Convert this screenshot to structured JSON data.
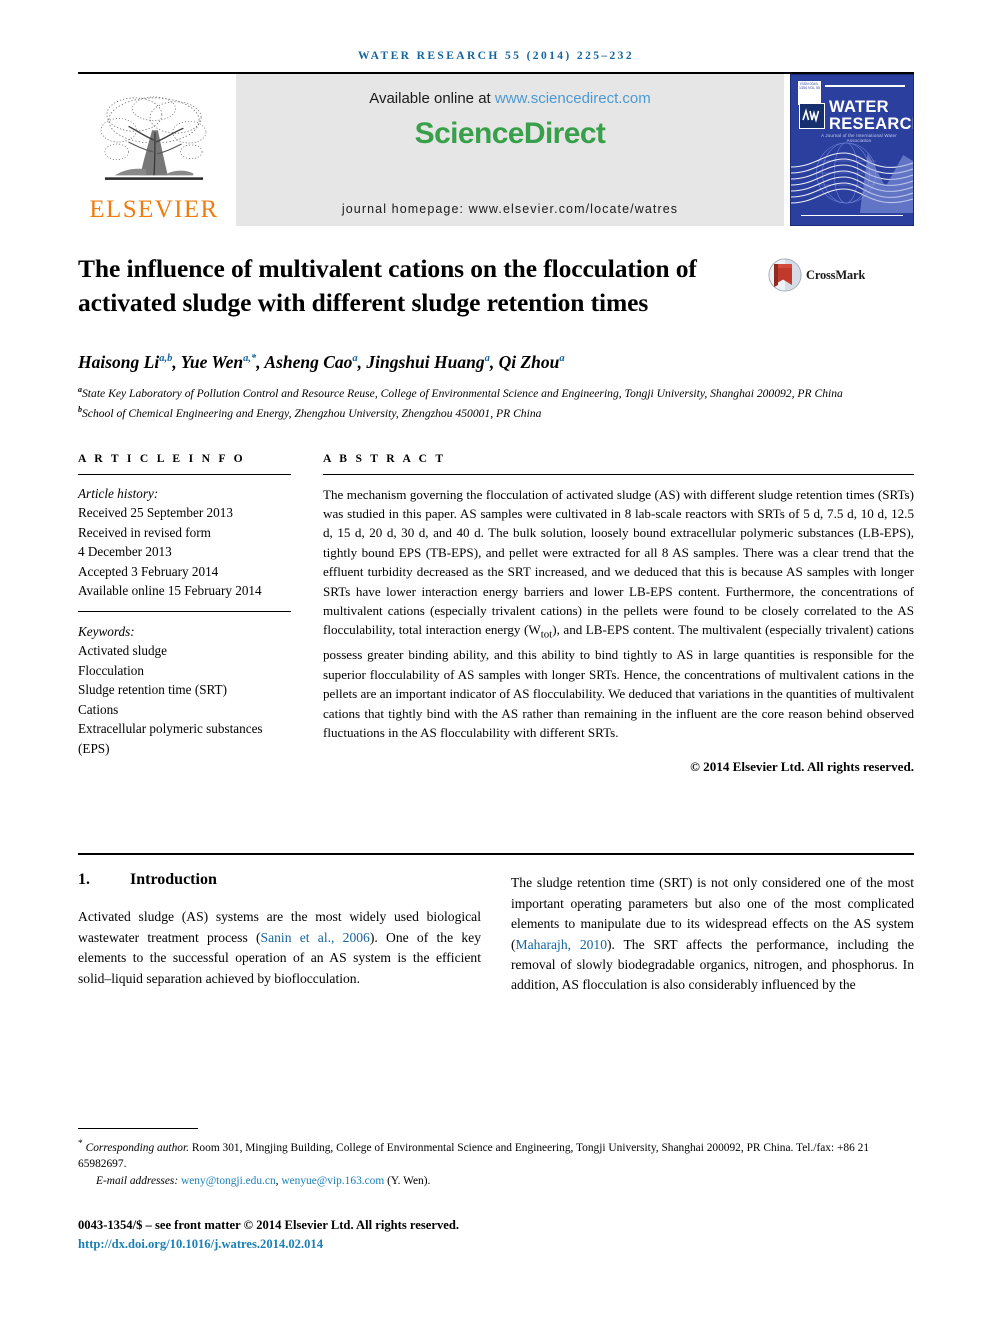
{
  "running_head": "WATER RESEARCH 55 (2014) 225–232",
  "masthead": {
    "publisher_name": "ELSEVIER",
    "available_prefix": "Available online at ",
    "available_url": "www.sciencedirect.com",
    "sciencedirect_logo": "ScienceDirect",
    "journal_homepage": "journal homepage: www.elsevier.com/locate/watres",
    "cover": {
      "title_line1": "WATER",
      "title_line2": "RESEARCH",
      "association_line": "A Journal of the International Water Association",
      "iwa_mark": "IWA",
      "stamp_text": "ISSN 0043-1354 VOL 55"
    },
    "colors": {
      "banner_bg": "#e6e6e6",
      "sciencedirect_green": "#38a04a",
      "link_blue": "#4b9ad4",
      "elsevier_orange": "#ee7d11",
      "cover_blue": "#2b3f9e",
      "running_head_blue": "#15669e"
    }
  },
  "article": {
    "title": "The influence of multivalent cations on the flocculation of activated sludge with different sludge retention times",
    "crossmark_label": "CrossMark",
    "authors": [
      {
        "name": "Haisong Li",
        "sup": "a,b",
        "sep": ", "
      },
      {
        "name": "Yue Wen",
        "sup": "a,*",
        "sep": ", "
      },
      {
        "name": "Asheng Cao",
        "sup": "a",
        "sep": ", "
      },
      {
        "name": "Jingshui Huang",
        "sup": "a",
        "sep": ", "
      },
      {
        "name": "Qi Zhou",
        "sup": "a",
        "sep": ""
      }
    ],
    "affiliations": [
      {
        "sup": "a",
        "text": "State Key Laboratory of Pollution Control and Resource Reuse, College of Environmental Science and Engineering, Tongji University, Shanghai 200092, PR China"
      },
      {
        "sup": "b",
        "text": "School of Chemical Engineering and Energy, Zhengzhou University, Zhengzhou 450001, PR China"
      }
    ]
  },
  "article_info": {
    "heading": "A R T I C L E   I N F O",
    "history_label": "Article history:",
    "history": [
      "Received 25 September 2013",
      "Received in revised form",
      "4 December 2013",
      "Accepted 3 February 2014",
      "Available online 15 February 2014"
    ],
    "keywords_label": "Keywords:",
    "keywords": [
      "Activated sludge",
      "Flocculation",
      "Sludge retention time (SRT)",
      "Cations",
      "Extracellular polymeric substances (EPS)"
    ]
  },
  "abstract": {
    "heading": "A B S T R A C T",
    "part1": "The mechanism governing the flocculation of activated sludge (AS) with different sludge retention times (SRTs) was studied in this paper. AS samples were cultivated in 8 lab-scale reactors with SRTs of 5 d, 7.5 d, 10 d, 12.5 d, 15 d, 20 d, 30 d, and 40 d. The bulk solution, loosely bound extracellular polymeric substances (LB-EPS), tightly bound EPS (TB-EPS), and pellet were extracted for all 8 AS samples. There was a clear trend that the effluent turbidity decreased as the SRT increased, and we deduced that this is because AS samples with longer SRTs have lower interaction energy barriers and lower LB-EPS content. Furthermore, the concentrations of multivalent cations (especially trivalent cations) in the pellets were found to be closely correlated to the AS flocculability, total interaction energy (W",
    "sub": "tot",
    "part2": "), and LB-EPS content. The multivalent (especially trivalent) cations possess greater binding ability, and this ability to bind tightly to AS in large quantities is responsible for the superior flocculability of AS samples with longer SRTs. Hence, the concentrations of multivalent cations in the pellets are an important indicator of AS flocculability. We deduced that variations in the quantities of multivalent cations that tightly bind with the AS rather than remaining in the influent are the core reason behind observed fluctuations in the AS flocculability with different SRTs.",
    "copyright": "© 2014 Elsevier Ltd. All rights reserved."
  },
  "introduction": {
    "number": "1.",
    "heading": "Introduction",
    "left_p1_a": "Activated sludge (AS) systems are the most widely used biological wastewater treatment process (",
    "left_p1_cite": "Sanin et al., 2006",
    "left_p1_b": "). One of the key elements to the successful operation of an AS system is the efficient solid–liquid separation achieved by bioflocculation.",
    "right_p1_a": "The sludge retention time (SRT) is not only considered one of the most important operating parameters but also one of the most complicated elements to manipulate due to its widespread effects on the AS system (",
    "right_p1_cite": "Maharajh, 2010",
    "right_p1_b": "). The SRT affects the performance, including the removal of slowly biodegradable organics, nitrogen, and phosphorus. In addition, AS flocculation is also considerably influenced by the"
  },
  "footnote": {
    "star": "*",
    "corresponding_label": "Corresponding author.",
    "corresponding_text": " Room 301, Mingjing Building, College of Environmental Science and Engineering, Tongji University, Shanghai 200092, PR China. Tel./fax: +86 21 65982697.",
    "email_label": "E-mail addresses:",
    "email1": "weny@tongji.edu.cn",
    "email_sep": ", ",
    "email2": "wenyue@vip.163.com",
    "email_suffix": " (Y. Wen)."
  },
  "bottom": {
    "issn_line": "0043-1354/$ – see front matter © 2014 Elsevier Ltd. All rights reserved.",
    "doi": "http://dx.doi.org/10.1016/j.watres.2014.02.014"
  }
}
